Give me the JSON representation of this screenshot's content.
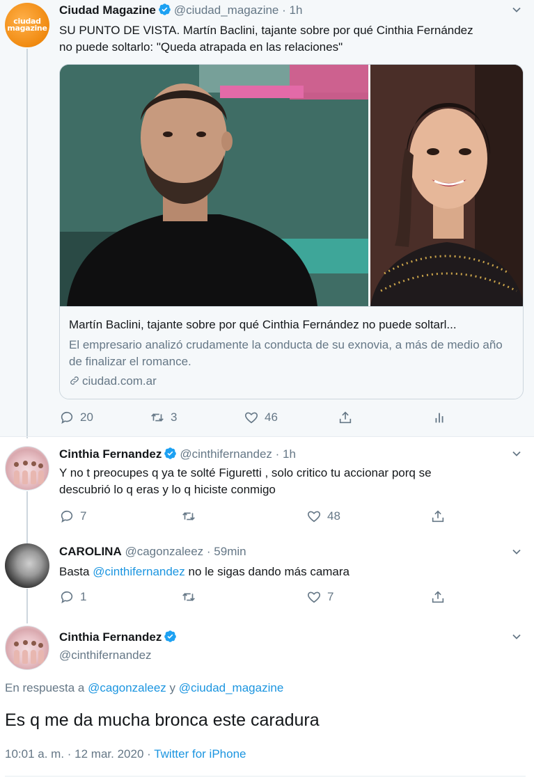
{
  "tweet1": {
    "name": "Ciudad Magazine",
    "handle": "@ciudad_magazine",
    "time": "· 1h",
    "avatar_text_1": "ciudad",
    "avatar_text_2": "magazine",
    "text_line1": "SU PUNTO DE VISTA. Martín Baclini, tajante sobre por qué Cinthia Fernández",
    "text_line2": "no puede soltarlo: \"Queda atrapada en las relaciones\"",
    "card": {
      "title": "Martín Baclini, tajante sobre por qué Cinthia Fernández no puede soltarl...",
      "description": "El empresario analizó crudamente la conducta de su exnovia, a más de medio año de finalizar el romance.",
      "domain": "ciudad.com.ar"
    },
    "replies": "20",
    "retweets": "3",
    "likes": "46"
  },
  "tweet2": {
    "name": "Cinthia Fernandez",
    "handle": "@cinthifernandez",
    "time": "· 1h",
    "text_line1": "Y no t preocupes q ya te solté Figuretti , solo critico tu accionar porq se",
    "text_line2": "descubrió lo q eras y lo q hiciste conmigo",
    "replies": "7",
    "retweets": "",
    "likes": "48"
  },
  "tweet3": {
    "name": "CAROLINA",
    "handle": "@cagonzaleez",
    "time": "· 59min",
    "text_prefix": "Basta ",
    "mention": "@cinthifernandez",
    "text_suffix": " no le sigas dando más camara",
    "replies": "1",
    "retweets": "",
    "likes": "7"
  },
  "tweet4": {
    "name": "Cinthia Fernandez",
    "handle": "@cinthifernandez",
    "reply_prefix": "En respuesta a ",
    "reply_user1": "@cagonzaleez",
    "reply_and": " y ",
    "reply_user2": "@ciudad_magazine",
    "text": "Es q me da mucha bronca este caradura",
    "timestamp": "10:01 a. m. · 12 mar. 2020 · ",
    "source": "Twitter for iPhone"
  },
  "colors": {
    "verified": "#1da1f2",
    "link": "#1b95e0",
    "muted": "#657786",
    "thread_bg": "#f5f8fa"
  }
}
